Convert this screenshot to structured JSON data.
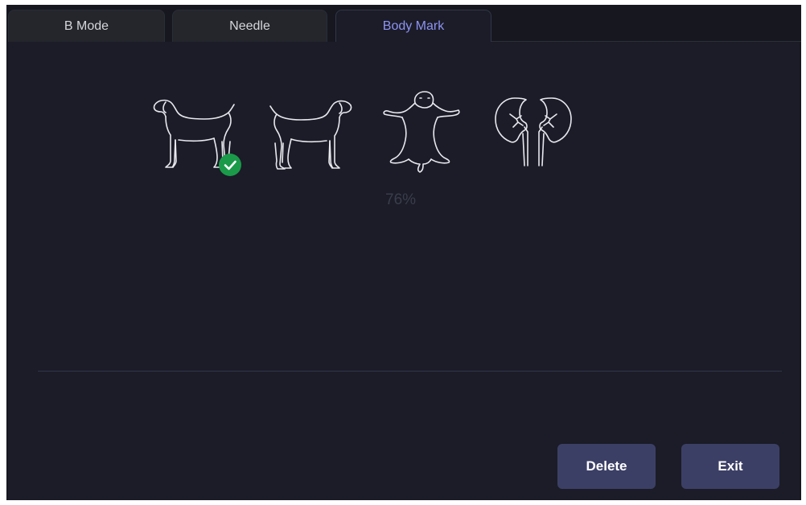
{
  "tabs": [
    {
      "label": "B Mode",
      "active": false
    },
    {
      "label": "Needle",
      "active": false
    },
    {
      "label": "Body Mark",
      "active": true
    }
  ],
  "body_marks": [
    {
      "name": "dog-left-lateral-icon",
      "selected": true
    },
    {
      "name": "dog-right-lateral-icon",
      "selected": false
    },
    {
      "name": "dog-dorsal-icon",
      "selected": false
    },
    {
      "name": "kidneys-icon",
      "selected": false
    }
  ],
  "percent_label": "76%",
  "buttons": {
    "delete_label": "Delete",
    "exit_label": "Exit"
  },
  "colors": {
    "background": "#1b1c27",
    "active_tab_text": "#8d93f2",
    "button": "#3c3f65",
    "check": "#1b9a4a"
  }
}
